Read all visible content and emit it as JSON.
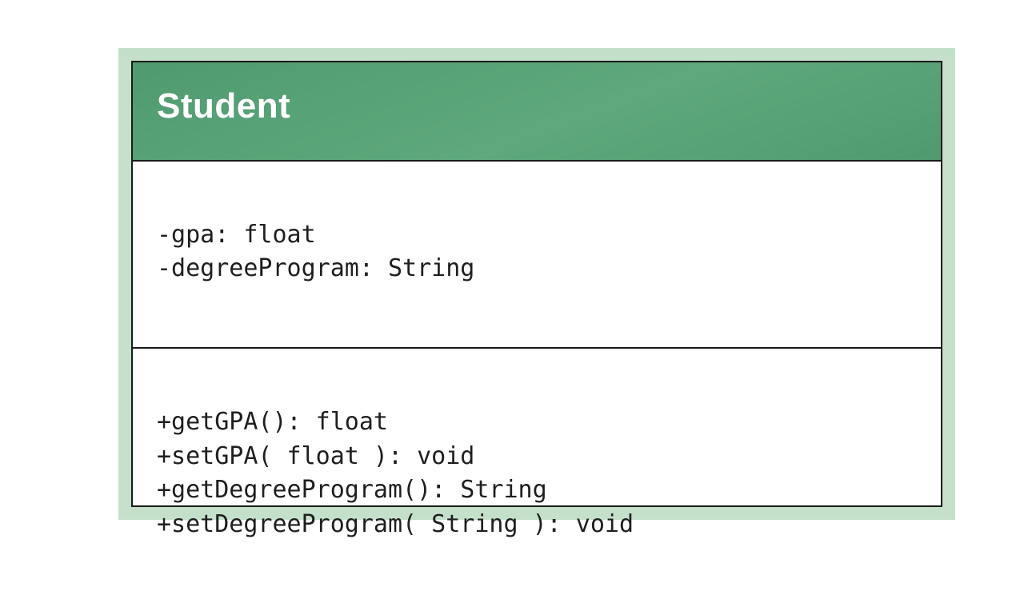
{
  "class": {
    "name": "Student",
    "attributes": [
      "-gpa: float",
      "-degreeProgram: String"
    ],
    "methods": [
      "+getGPA(): float",
      "+setGPA( float ): void",
      "+getDegreeProgram(): String",
      "+setDegreeProgram( String ): void"
    ]
  }
}
